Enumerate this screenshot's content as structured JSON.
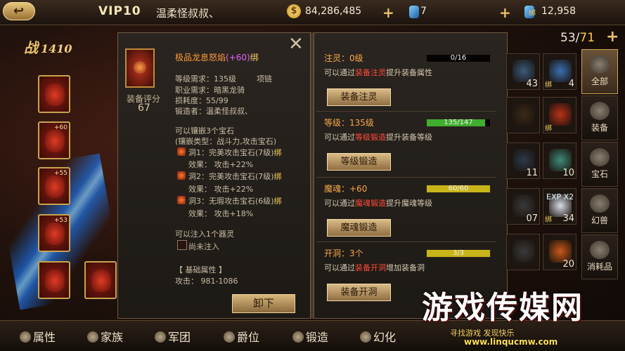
{
  "topbar": {
    "back_icon": "back-arrow-icon",
    "vip": "VIP10",
    "player_name": "温柔怪叔叔、",
    "gold": "84,286,485",
    "gems": "7",
    "bound_gem_prefix": "绑",
    "bound_gems": "12,958"
  },
  "battle": {
    "label": "战",
    "power": "1410"
  },
  "equip_slots": [
    {
      "level": ""
    },
    {
      "level": "+60"
    },
    {
      "level": "+55"
    },
    {
      "level": "+53"
    },
    {
      "level": ""
    },
    {
      "level": ""
    }
  ],
  "tooltip": {
    "title": "极品龙息怒焰",
    "plus": "(+60)",
    "bind": "绑",
    "score_label": "装备评分",
    "score": "67",
    "req_level": "等级需求：135级",
    "slot_type": "项链",
    "req_job": "职业需求：暗黑龙骑",
    "durability": "损耗度：55/99",
    "forger": "锻造者：温柔怪叔叔、",
    "socket_line": "可以镶嵌3个宝石",
    "socket_type": "(镶嵌类型：战斗力,攻击宝石)",
    "sockets": [
      {
        "name": "洞1：完美攻击宝石(7级)",
        "bind": "绑",
        "effect": "效果：  攻击+22%"
      },
      {
        "name": "洞2：完美攻击宝石(7级)",
        "bind": "绑",
        "effect": "效果：  攻击+22%"
      },
      {
        "name": "洞3：无瑕攻击宝石(6级)",
        "bind": "绑",
        "effect": "效果：  攻击+18%"
      }
    ],
    "spirit_line": "可以注入1个器灵",
    "spirit_status": "尚未注入",
    "base_attr_header": "【 基础属性 】",
    "attack": "攻击：  981-1086",
    "unload_label": "卸下"
  },
  "upgrades": [
    {
      "head": "注灵：0级",
      "bar_text": "0/16",
      "bar_fill": 0,
      "bar_color": "#3fae2e",
      "desc_pre": "可以通过",
      "desc_link": "装备注灵",
      "desc_post": "提升装备属性",
      "button": "装备注灵"
    },
    {
      "head": "等级：135级",
      "bar_text": "135/147",
      "bar_fill": 0.918,
      "bar_color": "#3fae2e",
      "desc_pre": "可以通过",
      "desc_link": "等级锻造",
      "desc_post": "提升装备等级",
      "button": "等级锻造"
    },
    {
      "head": "魔魂：+60",
      "bar_text": "60/60",
      "bar_fill": 1,
      "bar_color": "#c7b51a",
      "desc_pre": "可以通过",
      "desc_link": "魔魂锻造",
      "desc_post": "提升魔魂等级",
      "button": "魔魂锻造"
    },
    {
      "head": "开洞：3个",
      "bar_text": "3/3",
      "bar_fill": 1,
      "bar_color": "#c7b51a",
      "desc_pre": "可以通过",
      "desc_link": "装备开洞",
      "desc_post": "增加装备洞",
      "button": "装备开洞"
    }
  ],
  "inventory": {
    "used": "53",
    "sep": "/",
    "max": "71",
    "items": [
      {
        "count": "43",
        "bind": "",
        "exp": "",
        "color": "#3a5a7a"
      },
      {
        "count": "4",
        "bind": "绑",
        "exp": "",
        "color": "#3a6fb0"
      },
      {
        "count": "",
        "bind": "",
        "exp": "",
        "color": "#3a2a1a"
      },
      {
        "count": "",
        "bind": "绑",
        "exp": "",
        "color": "#b8321a"
      },
      {
        "count": "11",
        "bind": "",
        "exp": "",
        "color": "#2a3a4a"
      },
      {
        "count": "10",
        "bind": "",
        "exp": "",
        "color": "#3f8a7a"
      },
      {
        "count": "07",
        "bind": "",
        "exp": "",
        "color": "#3a3a3a"
      },
      {
        "count": "34",
        "bind": "绑",
        "exp": "EXP X2",
        "color": "#d8dde6"
      },
      {
        "count": "",
        "bind": "",
        "exp": "",
        "color": "#3a3a3a"
      },
      {
        "count": "20",
        "bind": "",
        "exp": "",
        "color": "#c85a1a"
      }
    ]
  },
  "side_tabs": [
    "全部",
    "装备",
    "宝石",
    "幻兽",
    "消耗品"
  ],
  "bottom_nav": [
    "属性",
    "家族",
    "军团",
    "爵位",
    "锻造",
    "幻化"
  ],
  "watermark": {
    "title": "游戏传媒网",
    "slogan": "寻找游戏 发现快乐",
    "url": "www.linqucmw.com"
  }
}
